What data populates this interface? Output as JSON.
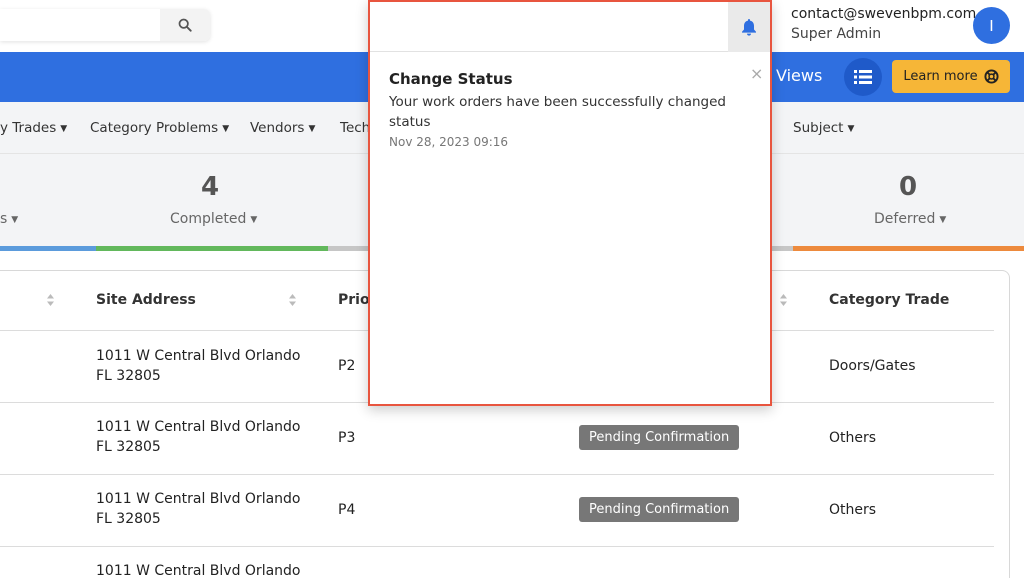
{
  "header": {
    "search_placeholder": "",
    "user_email": "contact@swevenbpm.com",
    "user_role": "Super Admin",
    "avatar_initial": "I"
  },
  "nav": {
    "views_label": "Views",
    "learn_more_label": "Learn more"
  },
  "filters": [
    {
      "label": "y Trades"
    },
    {
      "label": "Category Problems"
    },
    {
      "label": "Vendors"
    },
    {
      "label": "Tech"
    },
    {
      "label": "Subject"
    }
  ],
  "stats": [
    {
      "count": "",
      "label": "s"
    },
    {
      "count": "4",
      "label": "Completed"
    },
    {
      "count": "0",
      "label": "Deferred"
    }
  ],
  "colors": {
    "primary": "#2f6fe0",
    "accent": "#f6b637",
    "stripe_blue": "#5b9bdc",
    "stripe_green": "#62b85c",
    "stripe_gray": "#c6c6c6",
    "stripe_orange": "#ed8a3d",
    "highlight_border": "#e8553f",
    "badge_gray": "#777777"
  },
  "table": {
    "headers": {
      "site_address": "Site Address",
      "priority": "Prior",
      "category_trade": "Category Trade"
    },
    "rows": [
      {
        "address_line1": "1011 W Central Blvd Orlando",
        "address_line2": "FL 32805",
        "priority": "P2",
        "status": "",
        "trade": "Doors/Gates"
      },
      {
        "address_line1": "1011 W Central Blvd Orlando",
        "address_line2": "FL 32805",
        "priority": "P3",
        "status": "Pending Confirmation",
        "trade": "Others"
      },
      {
        "address_line1": "1011 W Central Blvd Orlando",
        "address_line2": "FL 32805",
        "priority": "P4",
        "status": "Pending Confirmation",
        "trade": "Others"
      },
      {
        "address_line1": "1011 W Central Blvd Orlando",
        "address_line2": "",
        "priority": "",
        "status": "",
        "trade": ""
      }
    ]
  },
  "notification": {
    "title": "Change Status",
    "message": "Your work orders have been successfully changed status",
    "time": "Nov 28, 2023 09:16",
    "close_glyph": "×"
  }
}
